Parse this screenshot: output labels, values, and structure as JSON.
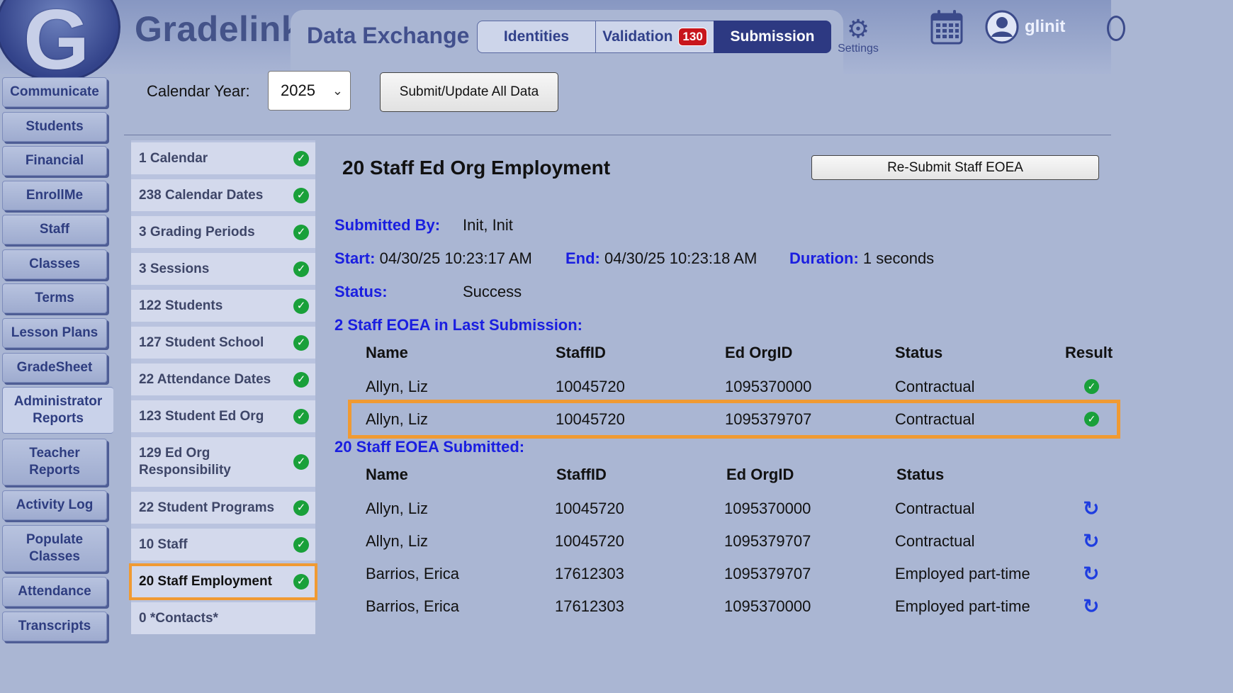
{
  "app": {
    "brand": "Gradelink",
    "logo_letter": "G",
    "module_title": "Data Exchange",
    "tabs": [
      {
        "label": "Identities"
      },
      {
        "label": "Validation",
        "badge": "130"
      },
      {
        "label": "Submission",
        "active": true
      }
    ],
    "settings_label": "Settings",
    "user_name": "glinit",
    "icons": [
      "settings-gear-icon",
      "calendar-icon",
      "user-avatar-icon"
    ]
  },
  "colors": {
    "accent": "#2d3982",
    "highlight": "#f09a32",
    "success": "#19a03a",
    "key_blue": "#1a1ee0"
  },
  "nav": [
    "Communicate",
    "Students",
    "Financial",
    "EnrollMe",
    "Staff",
    "Classes",
    "Terms",
    "Lesson Plans",
    "GradeSheet",
    "Administrator Reports",
    "Teacher Reports",
    "Activity Log",
    "Populate Classes",
    "Attendance",
    "Transcripts"
  ],
  "toolbar": {
    "calendar_year_label": "Calendar Year:",
    "calendar_year_value": "2025",
    "submit_all_label": "Submit/Update All Data"
  },
  "steps": [
    "1 Calendar",
    "238 Calendar Dates",
    "3 Grading Periods",
    "3 Sessions",
    "122 Students",
    "127 Student School",
    "22 Attendance Dates",
    "123 Student Ed Org",
    "129 Ed Org Responsibility",
    "22 Student Programs",
    "10 Staff",
    "20 Staff Employment",
    "0 *Contacts*"
  ],
  "selected_step": "20 Staff Employment",
  "detail": {
    "title": "20 Staff Ed Org Employment",
    "resubmit_label": "Re-Submit Staff EOEA",
    "submitted_by_label": "Submitted By:",
    "submitted_by": "Init, Init",
    "start_label": "Start:",
    "start": "04/30/25 10:23:17 AM",
    "end_label": "End:",
    "end": "04/30/25 10:23:18 AM",
    "duration_label": "Duration:",
    "duration": "1 seconds",
    "status_label": "Status:",
    "status": "Success",
    "last_submission_heading": "2 Staff EOEA in Last Submission:",
    "last_headers": [
      "Name",
      "StaffID",
      "Ed OrgID",
      "Status",
      "Result"
    ],
    "last_rows": [
      [
        "Allyn, Liz",
        "10045720",
        "1095370000",
        "Contractual"
      ],
      [
        "Allyn, Liz",
        "10045720",
        "1095379707",
        "Contractual"
      ]
    ],
    "submitted_heading": "20 Staff EOEA Submitted:",
    "submitted_headers": [
      "Name",
      "StaffID",
      "Ed OrgID",
      "Status"
    ],
    "submitted_rows": [
      [
        "Allyn, Liz",
        "10045720",
        "1095370000",
        "Contractual"
      ],
      [
        "Allyn, Liz",
        "10045720",
        "1095379707",
        "Contractual"
      ],
      [
        "Barrios, Erica",
        "17612303",
        "1095379707",
        "Employed part-time"
      ],
      [
        "Barrios, Erica",
        "17612303",
        "1095370000",
        "Employed part-time"
      ]
    ]
  }
}
